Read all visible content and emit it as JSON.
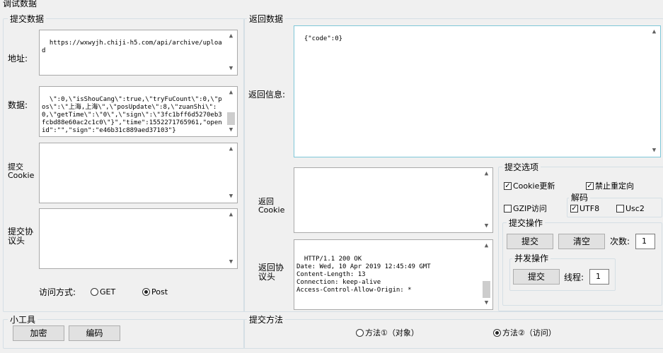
{
  "window_title": "调试数据",
  "submit_group": {
    "title": "提交数据",
    "address_label": "地址:",
    "address_value": "https://wxwyjh.chiji-h5.com/api/archive/upload",
    "data_label": "数据:",
    "data_value": "\\\":0,\\\"isShouCang\\\":true,\\\"tryFuCount\\\":0,\\\"pos\\\":\\\"上海,上海\\\",\\\"posUpdate\\\":8,\\\"zuanShi\\\":0,\\\"getTime\\\":\\\"0\\\",\\\"sign\\\":\\\"3fc1bff6d5270eb3fcbd88e60ac2c1c0\\\"}\",\"time\":1552271765961,\"openid\":\"\",\"sign\":\"e46b31c889aed37103\"}",
    "cookie_label": "提交\nCookie",
    "cookie_value": "",
    "protocol_label": "提交协议头",
    "protocol_value": "",
    "method_label": "访问方式:",
    "method_get": "GET",
    "method_post": "Post",
    "method_selected": "Post"
  },
  "return_group": {
    "title": "返回数据",
    "info_label": "返回信息:",
    "info_value": "{\"code\":0}",
    "cookie_label": "返回\nCookie",
    "cookie_value": "",
    "protocol_label": "返回协议头",
    "protocol_value": "HTTP/1.1 200 OK\nDate: Wed, 10 Apr 2019 12:45:49 GMT\nContent-Length: 13\nConnection: keep-alive\nAccess-Control-Allow-Origin: *"
  },
  "submit_options": {
    "title": "提交选项",
    "cookie_update": {
      "label": "Cookie更新",
      "checked": true
    },
    "no_redirect": {
      "label": "禁止重定向",
      "checked": true
    },
    "gzip": {
      "label": "GZIP访问",
      "checked": false
    },
    "decode_title": "解码",
    "utf8": {
      "label": "UTF8",
      "checked": true
    },
    "usc2": {
      "label": "Usc2",
      "checked": false
    }
  },
  "submit_ops": {
    "title": "提交操作",
    "submit_button": "提交",
    "clear_button": "清空",
    "count_label": "次数:",
    "count_value": "1"
  },
  "concurrent_ops": {
    "title": "并发操作",
    "submit_button": "提交",
    "threads_label": "线程:",
    "threads_value": "1"
  },
  "tools": {
    "title": "小工具",
    "encrypt_button": "加密",
    "encode_button": "编码"
  },
  "submit_method": {
    "title": "提交方法",
    "option1": "方法①（对象）",
    "option2": "方法②（访问）",
    "selected": "option2"
  }
}
